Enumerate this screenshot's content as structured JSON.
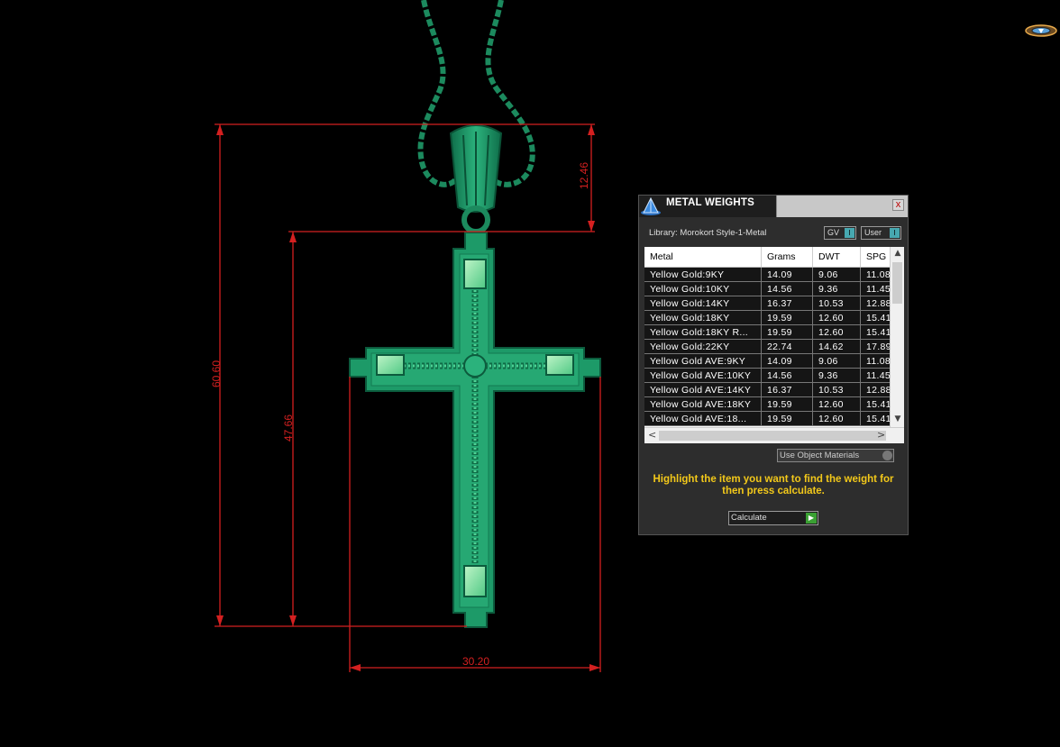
{
  "dimensions": {
    "overall_height": "60.60",
    "body_height": "47.66",
    "bail_height": "12.46",
    "width": "30.20"
  },
  "colors": {
    "dimension_line": "#d42020",
    "model": "#1e9a6a",
    "model_highlight": "#7ee8a8",
    "hint_text": "#f2c81a"
  },
  "panel": {
    "title": "METAL WEIGHTS",
    "close_label": "x",
    "library_label": "Library: Morokort Style-1-Metal",
    "gv_label": "GV",
    "user_label": "User",
    "toggle_indicator": "I",
    "use_object_materials": "Use Object Materials",
    "hint": "Highlight the item you want to find the weight for then press calculate.",
    "calculate_label": "Calculate"
  },
  "table": {
    "columns": [
      "Metal",
      "Grams",
      "DWT",
      "SPG"
    ],
    "rows": [
      [
        "Yellow Gold:9KY",
        "14.09",
        "9.06",
        "11.08"
      ],
      [
        "Yellow Gold:10KY",
        "14.56",
        "9.36",
        "11.45"
      ],
      [
        "Yellow Gold:14KY",
        "16.37",
        "10.53",
        "12.88"
      ],
      [
        "Yellow Gold:18KY",
        "19.59",
        "12.60",
        "15.41"
      ],
      [
        "Yellow Gold:18KY R...",
        "19.59",
        "12.60",
        "15.41"
      ],
      [
        "Yellow Gold:22KY",
        "22.74",
        "14.62",
        "17.89"
      ],
      [
        "Yellow Gold AVE:9KY",
        "14.09",
        "9.06",
        "11.08"
      ],
      [
        "Yellow Gold AVE:10KY",
        "14.56",
        "9.36",
        "11.45"
      ],
      [
        "Yellow Gold AVE:14KY",
        "16.37",
        "10.53",
        "12.88"
      ],
      [
        "Yellow Gold AVE:18KY",
        "19.59",
        "12.60",
        "15.41"
      ],
      [
        "Yellow Gold AVE:18...",
        "19.59",
        "12.60",
        "15.41"
      ]
    ]
  }
}
